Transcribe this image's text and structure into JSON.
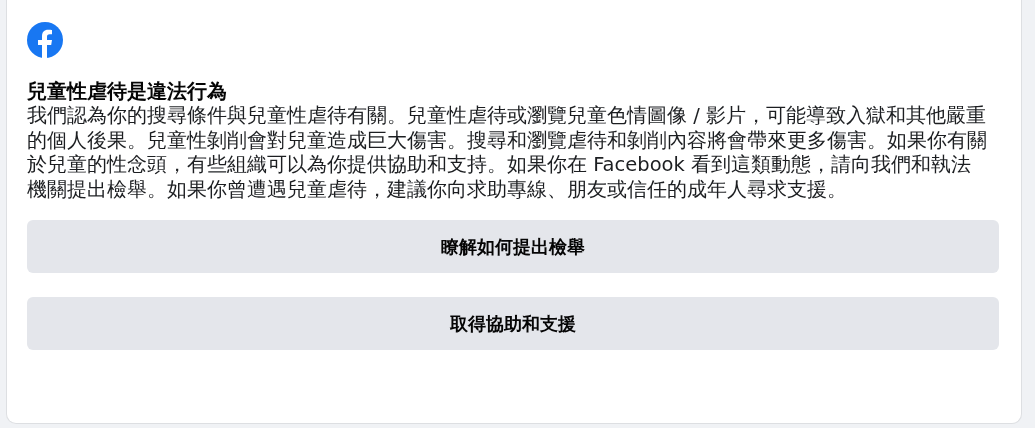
{
  "dialog": {
    "title": "兒童性虐待是違法行為",
    "message": "我們認為你的搜尋條件與兒童性虐待有關。兒童性虐待或瀏覽兒童色情圖像 / 影片，可能導致入獄和其他嚴重的個人後果。兒童性剝削會對兒童造成巨大傷害。搜尋和瀏覽虐待和剝削內容將會帶來更多傷害。如果你有關於兒童的性念頭，有些組織可以為你提供協助和支持。如果你在 Facebook 看到這類動態，請向我們和執法機關提出檢舉。如果你曾遭遇兒童虐待，建議你向求助專線、朋友或信任的成年人尋求支援。",
    "buttons": [
      {
        "label": "瞭解如何提出檢舉"
      },
      {
        "label": "取得協助和支援"
      }
    ]
  }
}
